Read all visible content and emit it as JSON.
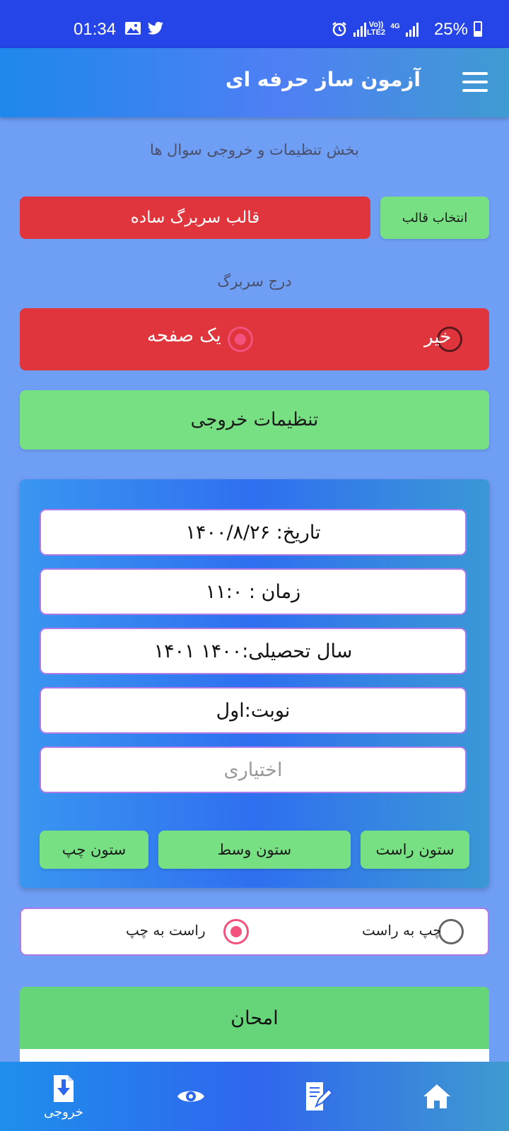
{
  "status": {
    "time": "01:34",
    "battery": "25%",
    "net_volte": "Vo)) LTE2",
    "net_4g": "4G"
  },
  "appbar": {
    "title": "آزمون ساز حرفه ای",
    "menu_icon": "hamburger-menu-icon"
  },
  "settings": {
    "caption": "بخش تنظیمات و خروجی سوال ها",
    "select_template_label": "انتخاب قالب",
    "template_value": "قالب سربرگ ساده",
    "header_caption": "درج سربرگ",
    "header_options": {
      "no": "خیر",
      "one_page": "یک صفحه",
      "selected": "one_page"
    },
    "output_settings_label": "تنظیمات خروجی"
  },
  "fields": {
    "date": "تاریخ: ۱۴۰۰/۸/۲۶",
    "time": "زمان : ۱۱:۰",
    "school_year": "سال تحصیلی:۱۴۰۰ ۱۴۰۱",
    "round": "نوبت:اول",
    "optional_placeholder": "اختیاری"
  },
  "columns": {
    "right": "ستون راست",
    "middle": "ستون وسط",
    "left": "ستون چپ"
  },
  "direction": {
    "ltr": "چپ به راست",
    "rtl": "راست به چپ",
    "selected": "rtl"
  },
  "exam": {
    "label": "امحان"
  },
  "bottomnav": {
    "output_label": "خروجی"
  },
  "colors": {
    "status_bar": "#2545e8",
    "background": "#6f9ef5",
    "green": "#77e083",
    "red": "#e0353c",
    "radio_selected": "#f3527f"
  }
}
